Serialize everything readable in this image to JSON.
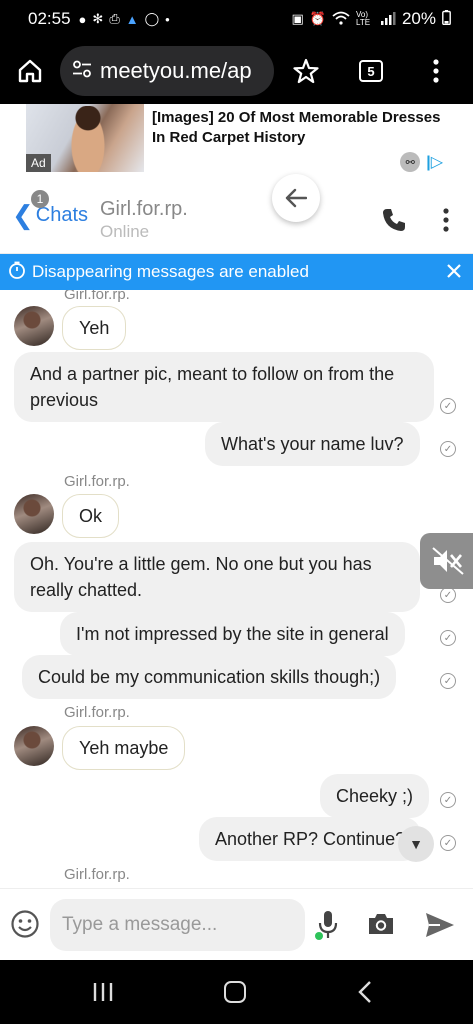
{
  "status_bar": {
    "time": "02:55",
    "left_icons": [
      "chat-bubble-icon",
      "settings-icon",
      "printer-icon",
      "cake-icon",
      "ring-icon",
      "dot-icon"
    ],
    "battery": "20%",
    "network": "Vo) LTE"
  },
  "browser": {
    "url": "meetyou.me/ap",
    "tab_count": "5"
  },
  "ad": {
    "title": "[Images] 20 Of Most Memorable Dresses In Red Carpet History",
    "tag": "Ad"
  },
  "chat_header": {
    "back_label": "Chats",
    "unread_count": "1",
    "contact_name": "Girl.for.rp.",
    "contact_status": "Online"
  },
  "banner": {
    "text": "Disappearing messages are enabled"
  },
  "messages": [
    {
      "type": "sender",
      "text": "Girl.for.rp."
    },
    {
      "type": "in",
      "text": "Yeh"
    },
    {
      "type": "in",
      "text": "And a partner pic, meant to follow on from the previous"
    },
    {
      "type": "out",
      "text": "What's your name luv?"
    },
    {
      "type": "sender",
      "text": "Girl.for.rp."
    },
    {
      "type": "in",
      "text": "Ok"
    },
    {
      "type": "in",
      "text": "Oh. You're a little gem. No one but you has really chatted."
    },
    {
      "type": "out",
      "text": "I'm not impressed by the site in general"
    },
    {
      "type": "out",
      "text": "Could be my communication skills though;)"
    },
    {
      "type": "sender",
      "text": "Girl.for.rp."
    },
    {
      "type": "in",
      "text": "Yeh maybe"
    },
    {
      "type": "out",
      "text": "Cheeky ;)"
    },
    {
      "type": "out",
      "text": "Another RP? Continue?"
    },
    {
      "type": "sender",
      "text": "Girl.for.rp."
    }
  ],
  "compose": {
    "placeholder": "Type a message..."
  }
}
